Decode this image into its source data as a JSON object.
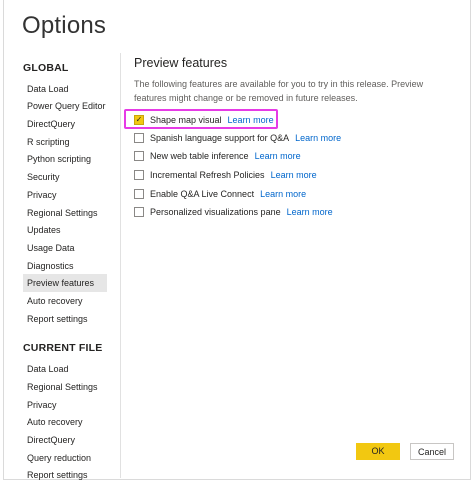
{
  "window": {
    "title": "Options"
  },
  "sidebar": {
    "global_heading": "GLOBAL",
    "global_items": [
      {
        "label": "Data Load"
      },
      {
        "label": "Power Query Editor"
      },
      {
        "label": "DirectQuery"
      },
      {
        "label": "R scripting"
      },
      {
        "label": "Python scripting"
      },
      {
        "label": "Security"
      },
      {
        "label": "Privacy"
      },
      {
        "label": "Regional Settings"
      },
      {
        "label": "Updates"
      },
      {
        "label": "Usage Data"
      },
      {
        "label": "Diagnostics"
      },
      {
        "label": "Preview features",
        "selected": true
      },
      {
        "label": "Auto recovery"
      },
      {
        "label": "Report settings"
      }
    ],
    "current_file_heading": "CURRENT FILE",
    "current_file_items": [
      {
        "label": "Data Load"
      },
      {
        "label": "Regional Settings"
      },
      {
        "label": "Privacy"
      },
      {
        "label": "Auto recovery"
      },
      {
        "label": "DirectQuery"
      },
      {
        "label": "Query reduction"
      },
      {
        "label": "Report settings"
      }
    ]
  },
  "main": {
    "heading": "Preview features",
    "description": "The following features are available for you to try in this release. Preview features might change or be removed in future releases.",
    "features": [
      {
        "label": "Shape map visual",
        "checked": true,
        "link": "Learn more"
      },
      {
        "label": "Spanish language support for Q&A",
        "checked": false,
        "link": "Learn more"
      },
      {
        "label": "New web table inference",
        "checked": false,
        "link": "Learn more"
      },
      {
        "label": "Incremental Refresh Policies",
        "checked": false,
        "link": "Learn more"
      },
      {
        "label": "Enable Q&A Live Connect",
        "checked": false,
        "link": "Learn more"
      },
      {
        "label": "Personalized visualizations pane",
        "checked": false,
        "link": "Learn more"
      }
    ]
  },
  "buttons": {
    "ok_label": "OK",
    "cancel_label": "Cancel"
  },
  "colors": {
    "accent": "#f2c811",
    "link": "#0066cc",
    "highlight": "#e63be6",
    "selected_bg": "#e6e6e6"
  },
  "icons": {
    "check": "checkmark-icon"
  }
}
